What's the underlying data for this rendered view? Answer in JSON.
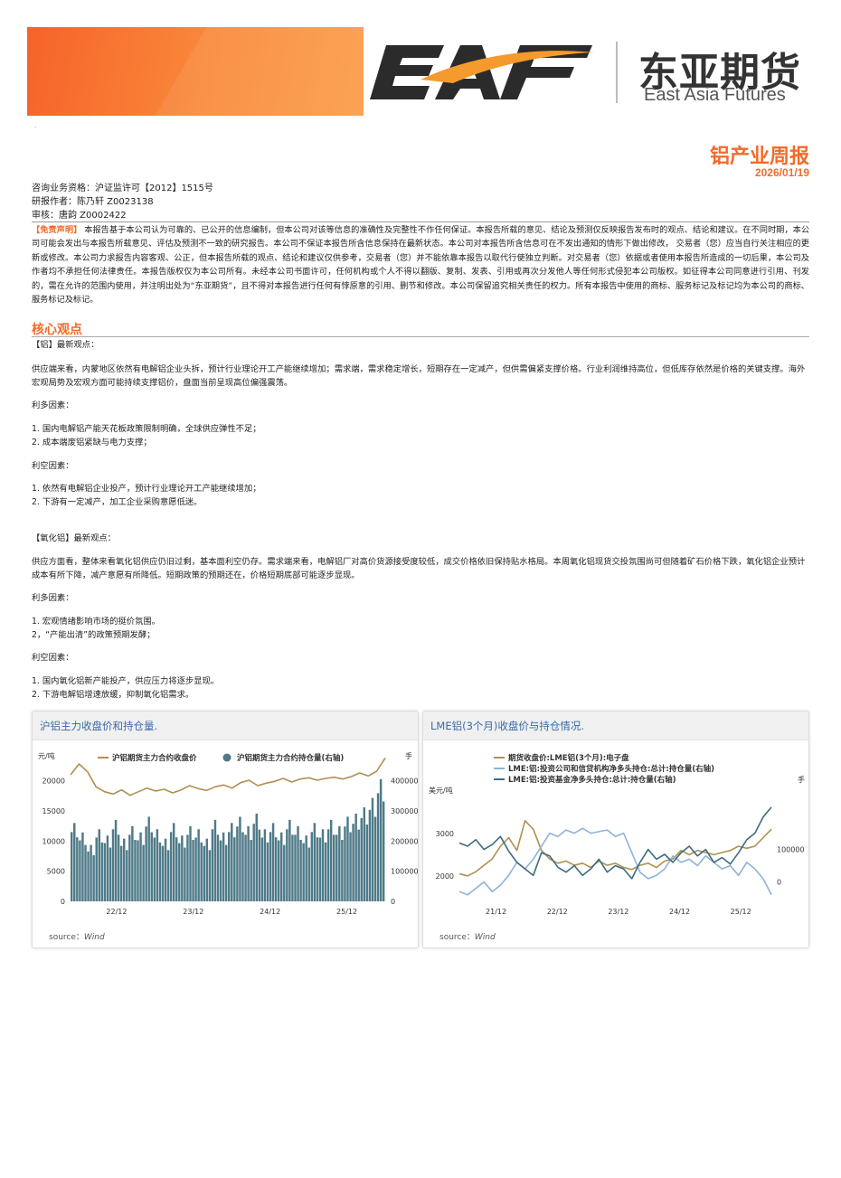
{
  "header": {
    "logo_cn": "东亚期货",
    "logo_en": "East Asia Futures",
    "report_title": "铝产业周报",
    "report_date": "2026/01/19"
  },
  "meta": {
    "line1": "咨询业务资格：沪证监许可【2012】1515号",
    "line2": "研报作者：陈乃轩 Z0023138",
    "line3": "审核：唐韵 Z0002422"
  },
  "disclaimer": {
    "tag": "【免责声明】",
    "text": "本报告基于本公司认为可靠的、已公开的信息编制，但本公司对该等信息的准确性及完整性不作任何保证。本报告所载的意见、结论及预测仅反映报告发布时的观点、结论和建议。在不同时期，本公司可能会发出与本报告所载意见、评估及预测不一致的研究报告。本公司不保证本报告所含信息保持在最新状态。本公司对本报告所含信息可在不发出通知的情形下做出修改， 交易者（您）应当自行关注相应的更新或修改。本公司力求报告内容客观、公正，但本报告所载的观点、结论和建议仅供参考，交易者（您）并不能依靠本报告以取代行使独立判断。对交易者（您）依据或者使用本报告所造成的一切后果，本公司及作者均不承担任何法律责任。本报告版权仅为本公司所有。未经本公司书面许可，任何机构或个人不得以翻版、复制、发表、引用或再次分发他人等任何形式侵犯本公司版权。如征得本公司同意进行引用、刊发的，需在允许的范围内使用，并注明出处为“东亚期货”，且不得对本报告进行任何有悖原意的引用、删节和修改。本公司保留追究相关责任的权力。所有本报告中使用的商标、服务标记及标记均为本公司的商标、服务标记及标记。"
  },
  "core": {
    "section_title": "核心观点",
    "al_head": "【铝】最新观点：",
    "al_view": "供应端来看，内蒙地区依然有电解铝企业头拆，预计行业理论开工产能继续增加；需求端，需求稳定增长，短期存在一定减产，但供需偏紧支撑价格。行业利润维持高位，但低库存依然是价格的关键支撑。海外宏观局势及宏观方面可能持续支撑铝价，盘面当前呈现高位偏强震荡。",
    "al_bull_head": "利多因素：",
    "al_bull_1": "1.  国内电解铝产能天花板政策限制明确，全球供应弹性不足；",
    "al_bull_2": "2.  成本端废铝紧缺与电力支撑；",
    "al_bear_head": "利空因素：",
    "al_bear_1": "1.  依然有电解铝企业投产，预计行业理论开工产能继续增加；",
    "al_bear_2": "2.  下游有一定减产，加工企业采购意愿低迷。",
    "ao_head": "【氧化铝】最新观点：",
    "ao_view": "供应方面看，整体来看氧化铝供应仍旧过剩，基本面利空仍存。需求端来看，电解铝厂对高价货源接受度较低，成交价格依旧保持贴水格局。本周氧化铝现货交投氛围尚可但随着矿石价格下跌，氧化铝企业预计成本有所下降，减产意愿有所降低。短期政策的预期还在，价格短期底部可能逐步显现。",
    "ao_bull_head": "利多因素：",
    "ao_bull_1": "1.  宏观情绪影响市场的挺价氛围。",
    "ao_bull_2": "2，“产能出清”的政策预期发酵；",
    "ao_bear_head": "利空因素：",
    "ao_bear_1": "1.  国内氧化铝新产能投产，供应压力将逐步显现。",
    "ao_bear_2": "2.  下游电解铝增速放缓，抑制氧化铝需求。"
  },
  "charts": {
    "left_title": "沪铝主力收盘价和持仓量.",
    "right_title": "LME铝(3个月)收盘价与持仓情况.",
    "source_label": "source：",
    "source_value": "Wind"
  },
  "chart_data": [
    {
      "type": "bar",
      "title": "沪铝主力收盘价和持仓量.",
      "ylabel": "元/吨",
      "y2label": "手",
      "ylim": [
        0,
        24000
      ],
      "y2lim": [
        0,
        480000
      ],
      "yticks": [
        0,
        5000,
        10000,
        15000,
        20000
      ],
      "y2ticks": [
        0,
        100000,
        200000,
        300000,
        400000
      ],
      "xticks": [
        "22/12",
        "23/12",
        "24/12",
        "25/12"
      ],
      "series": [
        {
          "name": "沪铝期货主力合约收盘价",
          "kind": "line",
          "color": "#b09050",
          "values": [
            21000,
            22800,
            21500,
            19000,
            18200,
            17800,
            18500,
            17600,
            18200,
            18800,
            18300,
            18600,
            18000,
            18500,
            19200,
            18700,
            18400,
            19000,
            19300,
            18800,
            19700,
            20100,
            19200,
            19600,
            19900,
            20400,
            19800,
            20300,
            20500,
            20100,
            20400,
            20600,
            20300,
            20700,
            21300,
            20800,
            21600,
            23800
          ]
        },
        {
          "name": "沪铝期货主力合约持仓量(右轴)",
          "kind": "bar",
          "color": "#4f7a88",
          "values": [
            250000,
            220000,
            180000,
            230000,
            210000,
            260000,
            200000,
            240000,
            220000,
            270000,
            230000,
            200000,
            250000,
            210000,
            240000,
            230000,
            200000,
            260000,
            220000,
            250000,
            270000,
            240000,
            280000,
            230000,
            250000,
            220000,
            260000,
            240000,
            210000,
            250000,
            230000,
            260000,
            240000,
            270000,
            280000,
            300000,
            330000,
            390000
          ]
        }
      ],
      "legend": "top"
    },
    {
      "type": "line",
      "title": "LME铝(3个月)收盘价与持仓情况.",
      "ylabel": "美元/吨",
      "y2label": "手",
      "ylim": [
        1400,
        4000
      ],
      "y2lim": [
        -60000,
        280000
      ],
      "yticks": [
        2000,
        3000
      ],
      "y2ticks": [
        0,
        100000
      ],
      "xticks": [
        "21/12",
        "22/12",
        "23/12",
        "24/12",
        "25/12"
      ],
      "series": [
        {
          "name": "期货收盘价:LME铝(3个月):电子盘",
          "color": "#b09050",
          "values": [
            2050,
            2000,
            2100,
            2250,
            2400,
            2700,
            2900,
            2600,
            3300,
            3100,
            2600,
            2400,
            2300,
            2350,
            2250,
            2300,
            2200,
            2350,
            2250,
            2300,
            2200,
            2150,
            2250,
            2300,
            2200,
            2350,
            2400,
            2600,
            2500,
            2600,
            2550,
            2500,
            2550,
            2600,
            2700,
            2650,
            2700,
            2900,
            3100
          ]
        },
        {
          "name": "LME:铝:投资公司和信贷机构净多头持仓:总计:持仓量(右轴)",
          "color": "#8fb2d8",
          "values": [
            -30000,
            -40000,
            -20000,
            0,
            -30000,
            -10000,
            20000,
            60000,
            40000,
            70000,
            110000,
            150000,
            140000,
            160000,
            150000,
            165000,
            150000,
            155000,
            160000,
            140000,
            150000,
            90000,
            30000,
            10000,
            20000,
            40000,
            80000,
            60000,
            70000,
            50000,
            80000,
            60000,
            40000,
            50000,
            20000,
            60000,
            40000,
            10000,
            -40000
          ]
        },
        {
          "name": "LME:铝:投资基金净多头持仓:总计:持仓量(右轴)",
          "color": "#3e6c80",
          "values": [
            120000,
            110000,
            130000,
            100000,
            115000,
            140000,
            95000,
            60000,
            40000,
            20000,
            90000,
            80000,
            45000,
            30000,
            50000,
            20000,
            40000,
            70000,
            30000,
            50000,
            40000,
            10000,
            60000,
            100000,
            70000,
            85000,
            60000,
            90000,
            110000,
            80000,
            100000,
            60000,
            75000,
            55000,
            90000,
            130000,
            150000,
            200000,
            230000
          ]
        }
      ],
      "legend": "top"
    }
  ]
}
